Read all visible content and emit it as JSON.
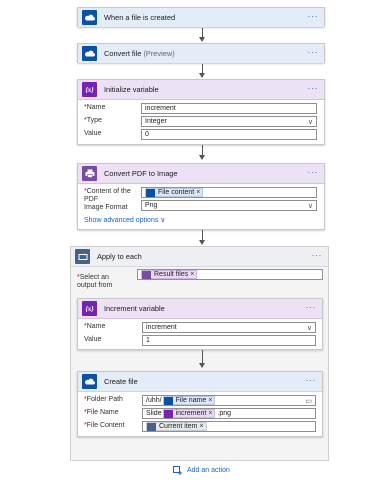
{
  "steps": {
    "trigger": {
      "title": "When a file is created"
    },
    "convert_file": {
      "title": "Convert file",
      "subtitle": "(Preview)"
    },
    "init_var": {
      "title": "Initialize variable",
      "name_label": "Name",
      "name_value": "increment",
      "type_label": "Type",
      "type_value": "Integer",
      "value_label": "Value",
      "value_value": "0"
    },
    "convert_pdf": {
      "title": "Convert PDF to Image",
      "content_label": "Content of the PDF",
      "content_token": "File content",
      "format_label": "Image Format",
      "format_value": "Png",
      "advanced_link": "Show advanced options"
    },
    "apply_each": {
      "title": "Apply to each",
      "select_label": "Select an output from",
      "select_token": "Result files"
    },
    "increment_var": {
      "title": "Increment variable",
      "name_label": "Name",
      "name_value": "increment",
      "value_label": "Value",
      "value_value": "1"
    },
    "create_file": {
      "title": "Create file",
      "folder_label": "Folder Path",
      "folder_prefix": "/uhh/",
      "folder_token": "File name",
      "filename_label": "File Name",
      "filename_prefix": "Slide",
      "filename_token": "increment",
      "filename_suffix": ".png",
      "filecontent_label": "File Content",
      "filecontent_token": "Current item"
    }
  },
  "add_action": "Add an action",
  "req_mark": "*",
  "token_close": "×",
  "more_icon": "···",
  "colors": {
    "onedrive": "#0a52a6",
    "variable": "#7723b1",
    "pdf": "#7a4ba4",
    "loop": "#47628a",
    "link": "#1b63c6"
  }
}
